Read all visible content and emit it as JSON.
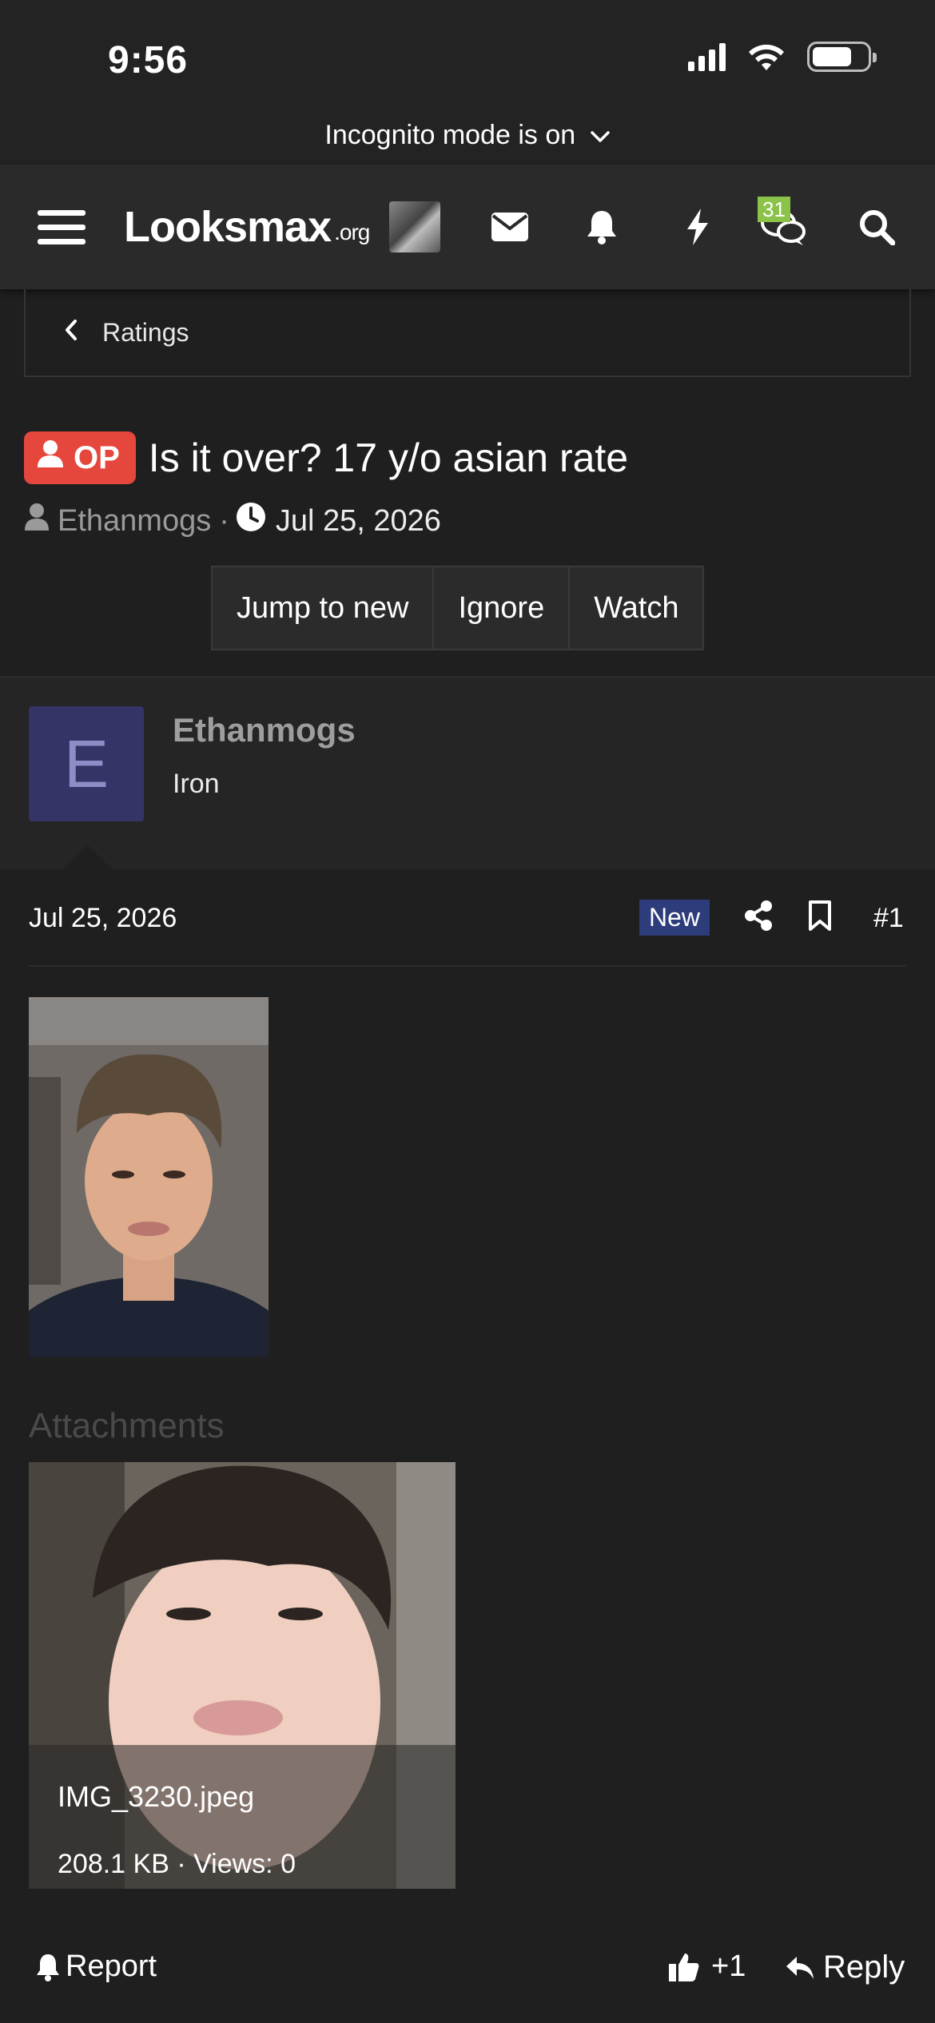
{
  "status_bar": {
    "time": "9:56"
  },
  "incognito": {
    "text": "Incognito mode is on"
  },
  "navbar": {
    "logo": "Looksmax",
    "logo_suffix": ".org",
    "chat_badge": "31",
    "icons": [
      "menu-icon",
      "mail-icon",
      "bell-icon",
      "bolt-icon",
      "chat-icon",
      "search-icon"
    ]
  },
  "breadcrumb": {
    "label": "Ratings"
  },
  "thread": {
    "prefix": "OP",
    "title": "Is it over? 17 y/o asian rate",
    "author": "Ethanmogs",
    "date": "Jul 25, 2026",
    "buttons": [
      "Jump to new",
      "Ignore",
      "Watch"
    ]
  },
  "post": {
    "avatar_letter": "E",
    "author": "Ethanmogs",
    "user_title": "Iron",
    "date": "Jul 25, 2026",
    "new_label": "New",
    "number": "#1",
    "attachments_heading": "Attachments",
    "attachment": {
      "filename": "IMG_3230.jpeg",
      "info": "208.1 KB · Views: 0"
    },
    "actions": {
      "report": "Report",
      "like": "+1",
      "reply": "Reply"
    }
  },
  "colors": {
    "background": "#1f1f1f",
    "op_badge": "#e5473d",
    "new_badge": "#2d3c7a",
    "chat_badge": "#8bc34a",
    "avatar": "#343566"
  }
}
